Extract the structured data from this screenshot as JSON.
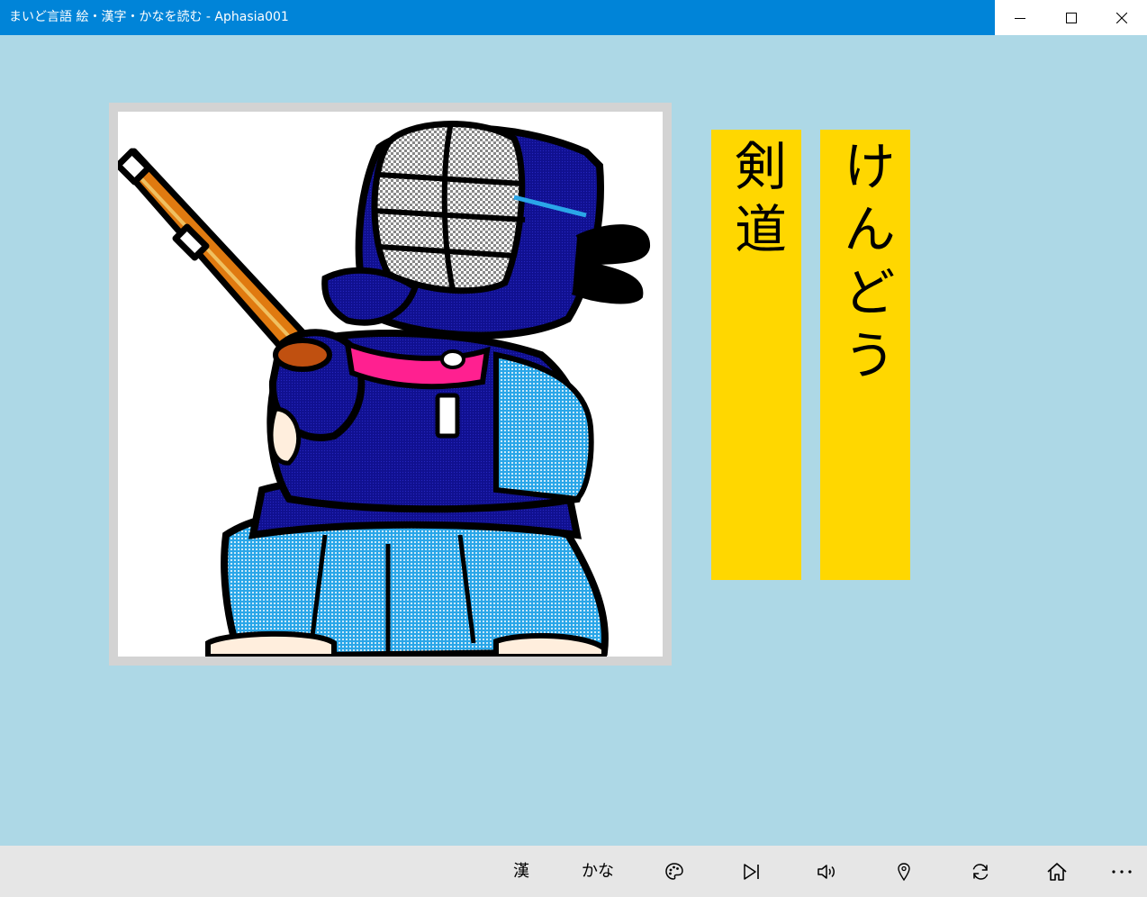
{
  "window": {
    "title": "まいど言語 絵・漢字・かなを読む - Aphasia001",
    "accent_color": "#0084d8",
    "controls": [
      "minimize-icon",
      "maximize-icon",
      "close-icon"
    ]
  },
  "page": {
    "background_color": "#add8e6"
  },
  "picture": {
    "subject_icon": "kendo-practitioner-illustration",
    "frame_color": "#d3d3d3"
  },
  "cards": {
    "kanji": "剣道",
    "kana": "けんどう",
    "color": "#ffd700"
  },
  "command_bar": {
    "background_color": "#e6e6e6",
    "kanji_label": "漢",
    "kana_label": "かな",
    "buttons": [
      "palette-icon",
      "skip-next-icon",
      "speaker-icon",
      "map-pin-icon",
      "refresh-icon",
      "home-icon",
      "more-icon"
    ],
    "more_label": "..."
  }
}
